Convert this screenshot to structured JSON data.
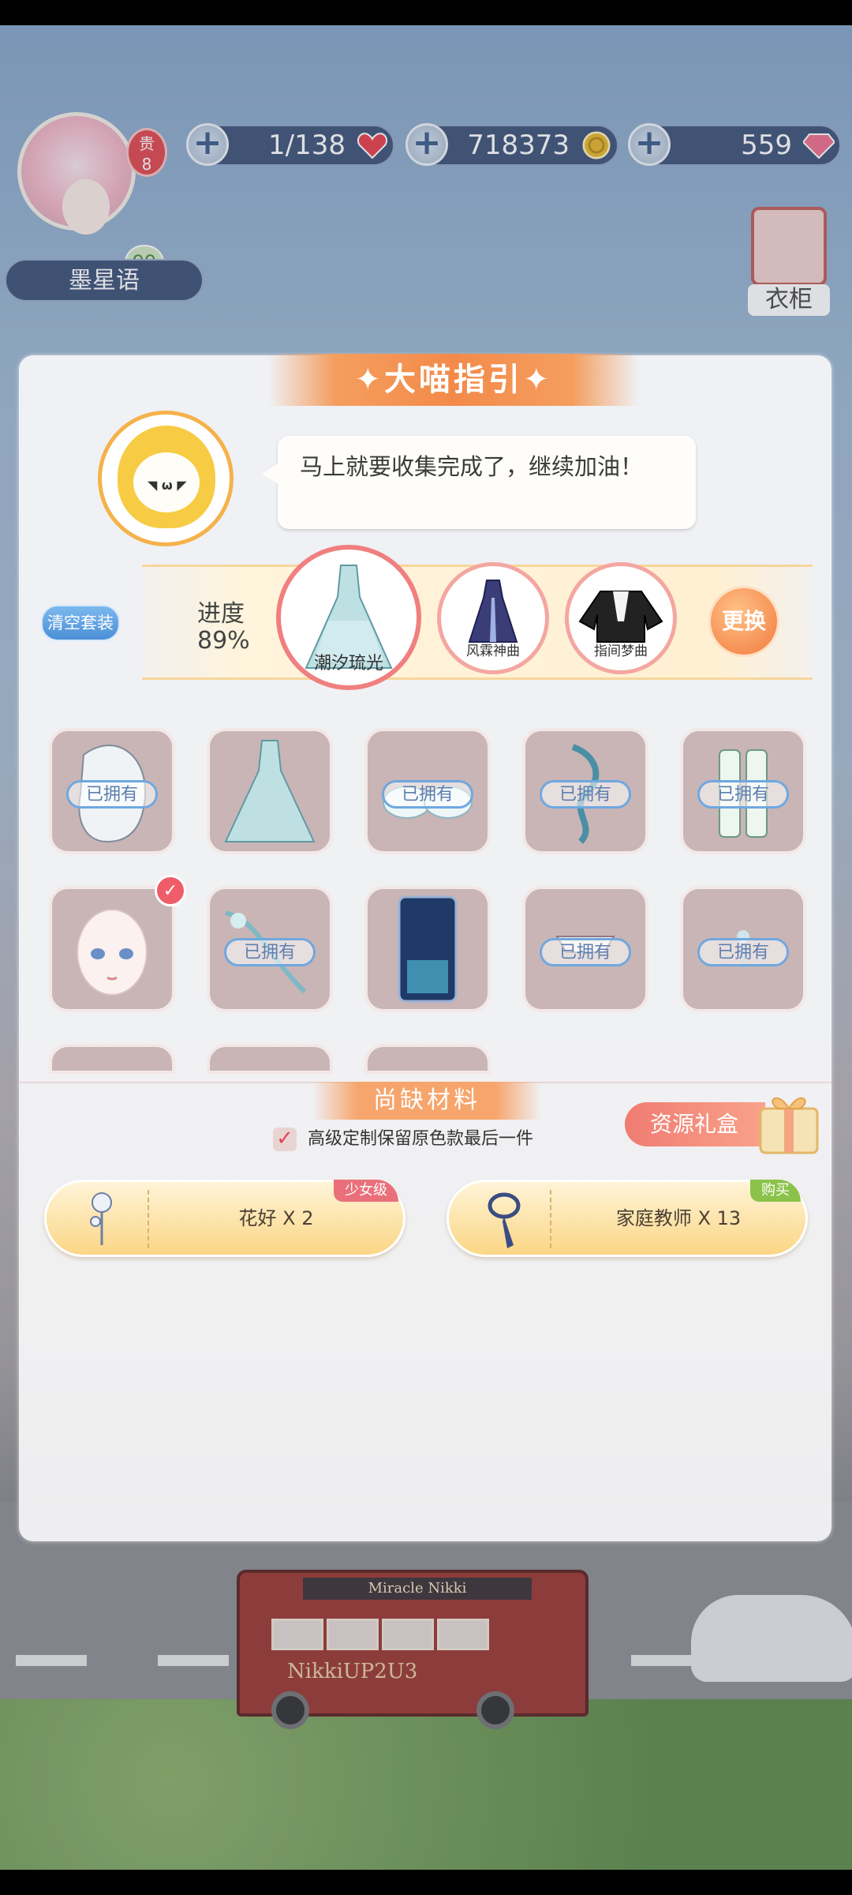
{
  "top_bar": {
    "vip_label": "贵",
    "vip_level": "8",
    "player_level": "99",
    "player_name": "墨星语",
    "resources": [
      {
        "value": "1/138",
        "icon": "heart-icon",
        "color": "#e8404a"
      },
      {
        "value": "718373",
        "icon": "gold-coin-icon",
        "color": "#e6b62c"
      },
      {
        "value": "559",
        "icon": "diamond-icon",
        "color": "#ee6f8d"
      }
    ],
    "wardrobe_label": "衣柜"
  },
  "guide": {
    "title": "✦大喵指引✦",
    "message": "马上就要收集完成了，继续加油！",
    "clear_label": "清空套装",
    "progress_label": "进度",
    "progress_value": "89%",
    "progress_fraction": 0.89,
    "change_label": "更换",
    "suits": [
      {
        "name": "潮汐琉光",
        "icon": "gown-icon"
      },
      {
        "name": "风霖神曲",
        "icon": "dress-icon"
      },
      {
        "name": "指间梦曲",
        "icon": "jacket-icon"
      }
    ]
  },
  "items": {
    "owned_label": "已拥有",
    "grid": [
      {
        "icon": "hair-icon",
        "owned": true
      },
      {
        "icon": "gown-icon",
        "owned": false
      },
      {
        "icon": "gloves-icon",
        "owned": true
      },
      {
        "icon": "necklace-icon",
        "owned": true
      },
      {
        "icon": "shoes-icon",
        "owned": true
      },
      {
        "icon": "makeup-icon",
        "owned": false,
        "selected": true
      },
      {
        "icon": "ornament-icon",
        "owned": true
      },
      {
        "icon": "background-icon",
        "owned": false
      },
      {
        "icon": "hair-ornament-icon",
        "owned": true
      },
      {
        "icon": "earring-icon",
        "owned": true
      }
    ]
  },
  "missing": {
    "title": "尚缺材料",
    "keep_option": "高级定制保留原色款最后一件",
    "gift_label": "资源礼盒",
    "materials": [
      {
        "name": "花好 X 2",
        "tag": "少女级",
        "tag_color": "#e9707a",
        "icon": "flower-hairpin-icon"
      },
      {
        "name": "家庭教师 X 13",
        "tag": "购买",
        "tag_color": "#8bc34a",
        "icon": "tie-icon"
      }
    ]
  },
  "scene": {
    "bus_banner": "Miracle Nikki",
    "bus_logo": "NikkiUP2U3"
  }
}
